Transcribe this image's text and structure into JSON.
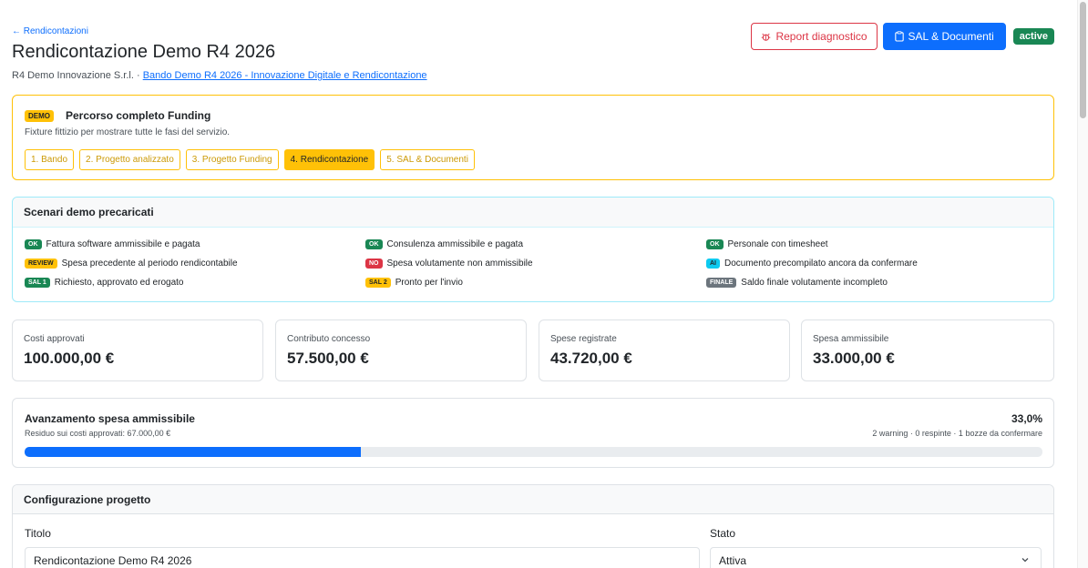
{
  "header": {
    "back_link": "← Rendicontazioni",
    "title": "Rendicontazione Demo R4 2026",
    "company": "R4 Demo Innovazione S.r.l. ·",
    "bando_link": "Bando Demo R4 2026 - Innovazione Digitale e Rendicontazione",
    "report_button": "Report diagnostico",
    "sal_button": "SAL & Documenti",
    "status_badge": "active"
  },
  "demo": {
    "badge": "DEMO",
    "title": "Percorso completo Funding",
    "subtitle": "Fixture fittizio per mostrare tutte le fasi del servizio.",
    "steps": [
      {
        "label": "1. Bando",
        "active": false
      },
      {
        "label": "2. Progetto analizzato",
        "active": false
      },
      {
        "label": "3. Progetto Funding",
        "active": false
      },
      {
        "label": "4. Rendicontazione",
        "active": true
      },
      {
        "label": "5. SAL & Documenti",
        "active": false
      }
    ]
  },
  "scenarios": {
    "title": "Scenari demo precaricati",
    "items": [
      {
        "tag": "OK",
        "kind": "ok",
        "text": "Fattura software ammissibile e pagata"
      },
      {
        "tag": "OK",
        "kind": "ok",
        "text": "Consulenza ammissibile e pagata"
      },
      {
        "tag": "OK",
        "kind": "ok",
        "text": "Personale con timesheet"
      },
      {
        "tag": "REVIEW",
        "kind": "review",
        "text": "Spesa precedente al periodo rendicontabile"
      },
      {
        "tag": "NO",
        "kind": "no",
        "text": "Spesa volutamente non ammissibile"
      },
      {
        "tag": "AI",
        "kind": "ai",
        "text": "Documento precompilato ancora da confermare"
      },
      {
        "tag": "SAL 1",
        "kind": "sal1",
        "text": "Richiesto, approvato ed erogato"
      },
      {
        "tag": "SAL 2",
        "kind": "sal2",
        "text": "Pronto per l'invio"
      },
      {
        "tag": "FINALE",
        "kind": "finale",
        "text": "Saldo finale volutamente incompleto"
      }
    ]
  },
  "metrics": [
    {
      "label": "Costi approvati",
      "value": "100.000,00 €"
    },
    {
      "label": "Contributo concesso",
      "value": "57.500,00 €"
    },
    {
      "label": "Spese registrate",
      "value": "43.720,00 €"
    },
    {
      "label": "Spesa ammissibile",
      "value": "33.000,00 €"
    }
  ],
  "progress": {
    "title": "Avanzamento spesa ammissibile",
    "residuo": "Residuo sui costi approvati: 67.000,00 €",
    "percent_label": "33,0%",
    "percent": 33.0,
    "stats": "2 warning · 0 respinte · 1 bozze da confermare"
  },
  "config": {
    "title": "Configurazione progetto",
    "titolo_label": "Titolo",
    "titolo_value": "Rendicontazione Demo R4 2026",
    "stato_label": "Stato",
    "stato_value": "Attiva"
  },
  "colors": {
    "primary": "#0d6efd",
    "danger": "#dc3545",
    "success": "#198754",
    "warning": "#ffc107",
    "info": "#0dcaf0",
    "secondary": "#6c757d"
  }
}
